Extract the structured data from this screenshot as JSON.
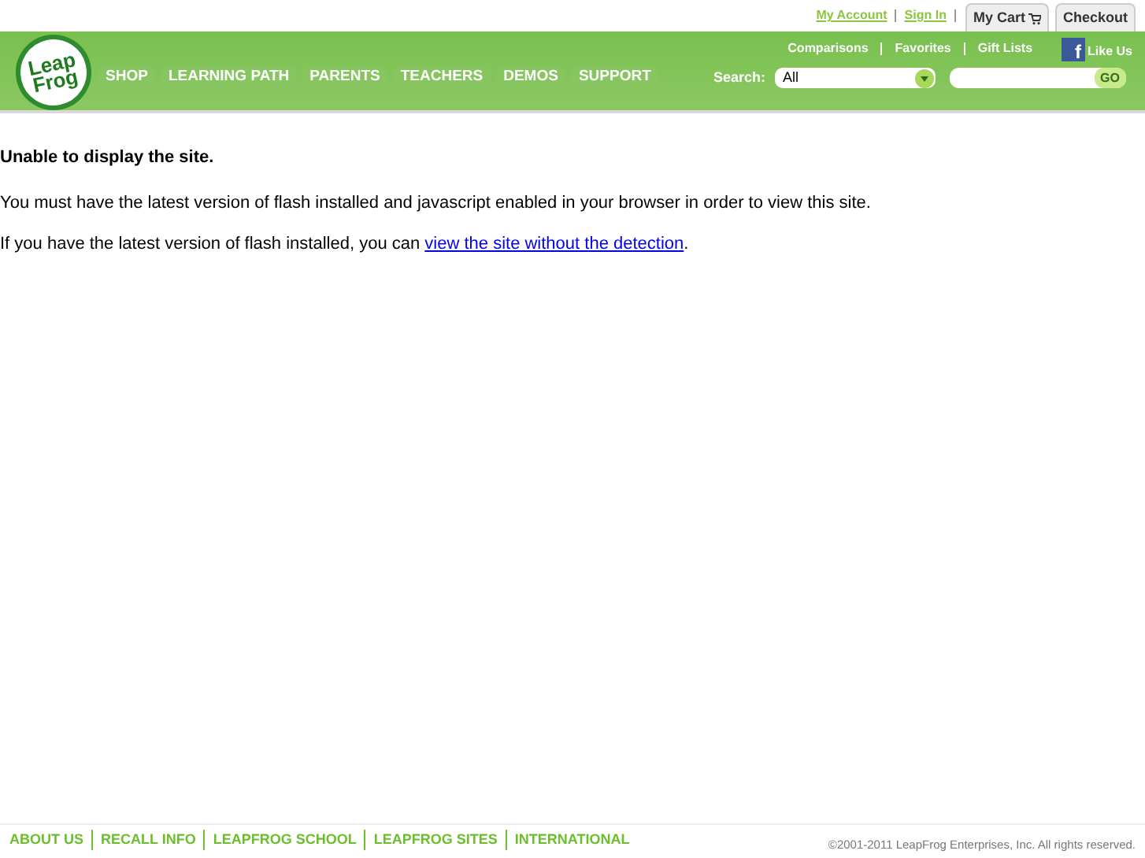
{
  "logo": {
    "line1": "Leap",
    "line2": "Frog"
  },
  "account_links": [
    "My Account",
    "Sign In"
  ],
  "tabs": [
    {
      "label": "My Cart",
      "kind": "cart"
    },
    {
      "label": "Checkout",
      "kind": "plain"
    }
  ],
  "utility_links": [
    "Comparisons",
    "Favorites",
    "Gift Lists"
  ],
  "like": {
    "label": "Like Us",
    "icon": "f"
  },
  "nav": [
    "SHOP",
    "LEARNING PATH",
    "PARENTS",
    "TEACHERS",
    "DEMOS",
    "SUPPORT"
  ],
  "search": {
    "label": "Search:",
    "category": "All",
    "button": "GO"
  },
  "content": {
    "heading": "Unable to display the site.",
    "message": "You must have the latest version of flash installed and javascript enabled in your browser in order to view this site.",
    "alt_before": "If you have the latest version of flash installed, you can ",
    "alt_link": "view the site without the detection",
    "alt_after": "."
  },
  "footer_links": [
    "ABOUT US",
    "RECALL INFO",
    "LEAPFROG SCHOOL",
    "LEAPFROG SITES",
    "INTERNATIONAL"
  ],
  "copyright": "©2001-2011 LeapFrog Enterprises, Inc. All rights reserved."
}
